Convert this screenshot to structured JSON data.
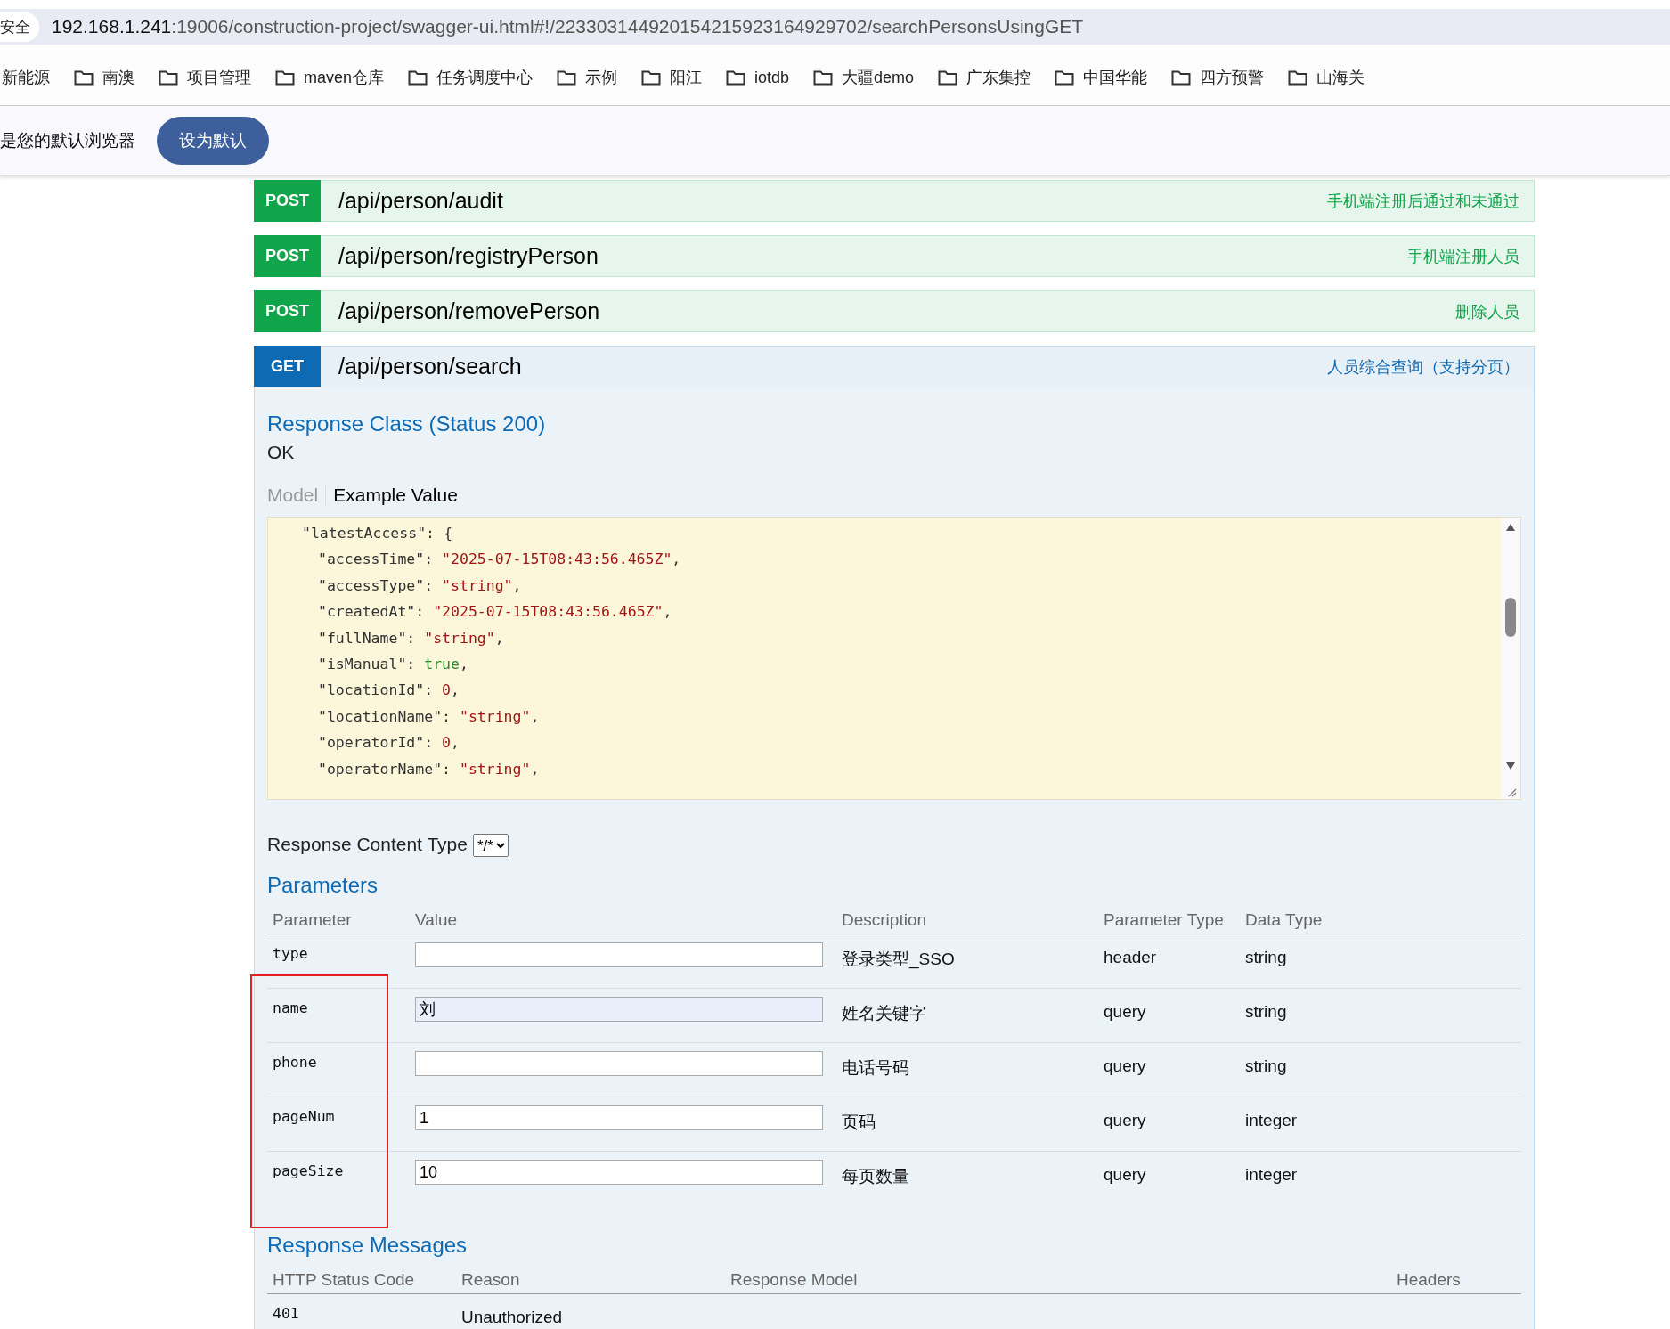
{
  "address_bar": {
    "security_label": "安全",
    "url_host": "192.168.1.241",
    "url_rest": ":19006/construction-project/swagger-ui.html#!/22330314492015421592316492970​2/searchPersonsUsingGET"
  },
  "bookmarks": [
    "新能源",
    "南澳",
    "项目管理",
    "maven仓库",
    "任务调度中心",
    "示例",
    "阳江",
    "iotdb",
    "大疆demo",
    "广东集控",
    "中国华能",
    "四方预警",
    "山海关"
  ],
  "info_bar": {
    "message": "是您的默认浏览器",
    "button": "设为默认"
  },
  "operations": [
    {
      "method": "POST",
      "path": "/api/person/audit",
      "summary": "手机端注册后通过和未通过",
      "expanded": false
    },
    {
      "method": "POST",
      "path": "/api/person/registryPerson",
      "summary": "手机端注册人员",
      "expanded": false
    },
    {
      "method": "POST",
      "path": "/api/person/removePerson",
      "summary": "删除人员",
      "expanded": false
    },
    {
      "method": "GET",
      "path": "/api/person/search",
      "summary": "人员综合查询（支持分页）",
      "expanded": true
    }
  ],
  "response_class": {
    "title": "Response Class (Status 200)",
    "status_text": "OK",
    "tabs": [
      {
        "label": "Model",
        "selected": false
      },
      {
        "label": "Example Value",
        "selected": true
      }
    ],
    "example_lines": [
      {
        "key": "\"latestAccess\":",
        "value": "{",
        "kind": "brace",
        "children": [
          {
            "key": "\"accessTime\":",
            "value": "\"2025-07-15T08:43:56.465Z\"",
            "kind": "string",
            "sep": ","
          },
          {
            "key": "\"accessType\":",
            "value": "\"string\"",
            "kind": "string",
            "sep": ","
          },
          {
            "key": "\"createdAt\":",
            "value": "\"2025-07-15T08:43:56.465Z\"",
            "kind": "string",
            "sep": ","
          },
          {
            "key": "\"fullName\":",
            "value": "\"string\"",
            "kind": "string",
            "sep": ","
          },
          {
            "key": "\"isManual\":",
            "value": "true",
            "kind": "bool",
            "sep": ","
          },
          {
            "key": "\"locationId\":",
            "value": "0",
            "kind": "number",
            "sep": ","
          },
          {
            "key": "\"locationName\":",
            "value": "\"string\"",
            "kind": "string",
            "sep": ","
          },
          {
            "key": "\"operatorId\":",
            "value": "0",
            "kind": "number",
            "sep": ","
          },
          {
            "key": "\"operatorName\":",
            "value": "\"string\"",
            "kind": "string",
            "sep": ","
          }
        ]
      }
    ]
  },
  "content_type": {
    "label": "Response Content Type",
    "value": "*/*"
  },
  "parameters": {
    "title": "Parameters",
    "columns": [
      "Parameter",
      "Value",
      "Description",
      "Parameter Type",
      "Data Type"
    ],
    "rows": [
      {
        "name": "type",
        "value": "",
        "description": "登录类型_SSO",
        "param_type": "header",
        "data_type": "string",
        "focused": false
      },
      {
        "name": "name",
        "value": "刘",
        "description": "姓名关键字",
        "param_type": "query",
        "data_type": "string",
        "focused": true
      },
      {
        "name": "phone",
        "value": "",
        "description": "电话号码",
        "param_type": "query",
        "data_type": "string",
        "focused": false
      },
      {
        "name": "pageNum",
        "value": "1",
        "description": "页码",
        "param_type": "query",
        "data_type": "integer",
        "focused": false
      },
      {
        "name": "pageSize",
        "value": "10",
        "description": "每页数量",
        "param_type": "query",
        "data_type": "integer",
        "focused": false
      }
    ]
  },
  "response_messages": {
    "title": "Response Messages",
    "columns": [
      "HTTP Status Code",
      "Reason",
      "Response Model",
      "Headers"
    ],
    "rows": [
      {
        "code": "401",
        "reason": "Unauthorized"
      }
    ]
  }
}
